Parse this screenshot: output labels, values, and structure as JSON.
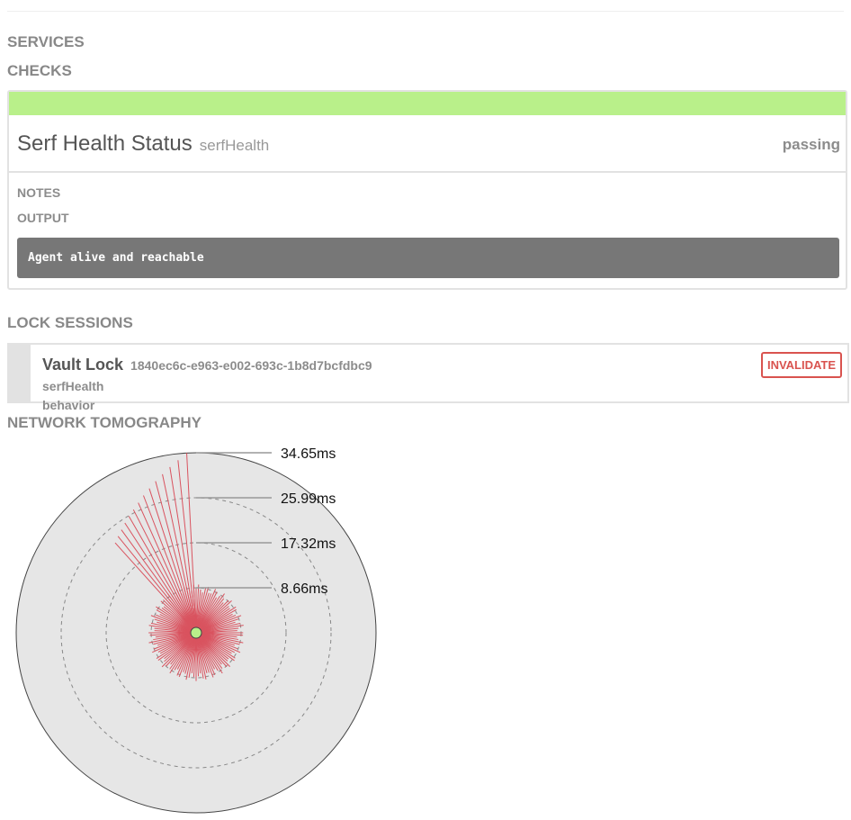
{
  "sections": {
    "services": "SERVICES",
    "checks": "CHECKS",
    "lock_sessions": "LOCK SESSIONS",
    "network_tomography": "NETWORK TOMOGRAPHY"
  },
  "check": {
    "name": "Serf Health Status",
    "id": "serfHealth",
    "status": "passing",
    "status_color": "#b9f08a",
    "notes_label": "NOTES",
    "output_label": "OUTPUT",
    "output": "Agent alive and reachable"
  },
  "lock": {
    "name": "Vault Lock",
    "id": "1840ec6c-e963-e002-693c-1b8d7bcfdbc9",
    "check": "serfHealth",
    "behavior": "behavior",
    "invalidate_label": "INVALIDATE",
    "accent_color": "#d9534f"
  },
  "tomography": {
    "ring_labels": [
      "34.65ms",
      "25.99ms",
      "17.32ms",
      "8.66ms"
    ],
    "max_ms": 34.65,
    "line_color": "#d9535f",
    "center_color": "#b9f08a",
    "long_segments_ms": [
      34.65,
      33.4,
      32.3,
      31.2,
      30.2,
      29.2,
      28.3,
      27.4,
      26.6,
      25.9,
      25.2,
      24.5,
      23.9,
      23.3
    ],
    "short_segments_ms": 9.3
  }
}
